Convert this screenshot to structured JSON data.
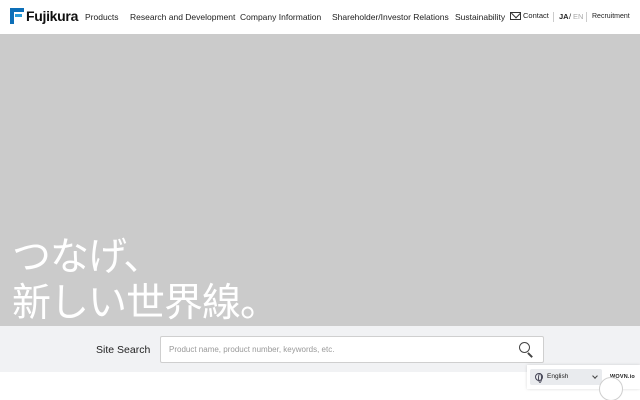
{
  "header": {
    "logo_text": "Fujikura",
    "nav": [
      {
        "id": "products",
        "label": "Products"
      },
      {
        "id": "rnd",
        "label": "Research and Development"
      },
      {
        "id": "company",
        "label": "Company Information"
      },
      {
        "id": "ir",
        "label": "Shareholder/Investor Relations"
      },
      {
        "id": "sustainability",
        "label": "Sustainability"
      }
    ],
    "contact_label": "Contact",
    "lang_ja": "JA",
    "lang_slash": "/",
    "lang_en": "EN",
    "recruitment": "Recruitment"
  },
  "hero": {
    "line1": "つなげ、",
    "line2": "新しい世界線。"
  },
  "search": {
    "label": "Site Search",
    "placeholder": "Product name, product number, keywords, etc."
  },
  "language_widget": {
    "selected": "English",
    "brand": "WOVN.io"
  },
  "colors": {
    "brand_blue": "#0d6fb8",
    "hero_bg": "#cbcbcb",
    "search_band_bg": "#f1f2f4"
  }
}
